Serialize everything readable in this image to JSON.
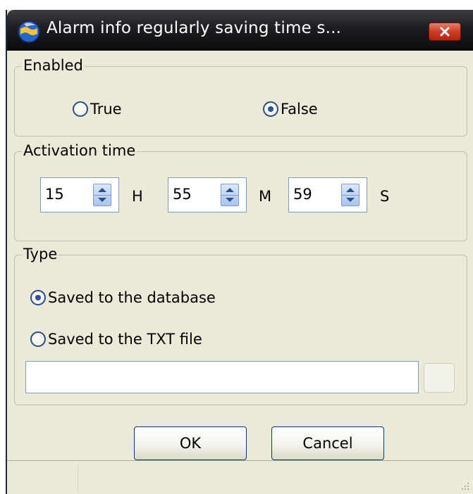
{
  "window": {
    "title": "Alarm info regularly saving time s...",
    "icon": "app-globe-icon",
    "close_icon": "close-icon"
  },
  "enabled": {
    "label": "Enabled",
    "options": [
      {
        "label": "True",
        "checked": false
      },
      {
        "label": "False",
        "checked": true
      }
    ]
  },
  "activation_time": {
    "label": "Activation time",
    "hours": {
      "value": "15",
      "unit": "H"
    },
    "minutes": {
      "value": "55",
      "unit": "M"
    },
    "seconds": {
      "value": "59",
      "unit": "S"
    }
  },
  "type": {
    "label": "Type",
    "options": [
      {
        "label": "Saved to the database",
        "checked": true
      },
      {
        "label": "Saved to the TXT file",
        "checked": false
      }
    ],
    "file_path": ""
  },
  "buttons": {
    "ok": "OK",
    "cancel": "Cancel"
  },
  "colors": {
    "dialog_bg": "#ece9d8",
    "titlebar": "#1e1e22",
    "close_button": "#cf3b23",
    "radio_dot": "#2f4fa0"
  }
}
